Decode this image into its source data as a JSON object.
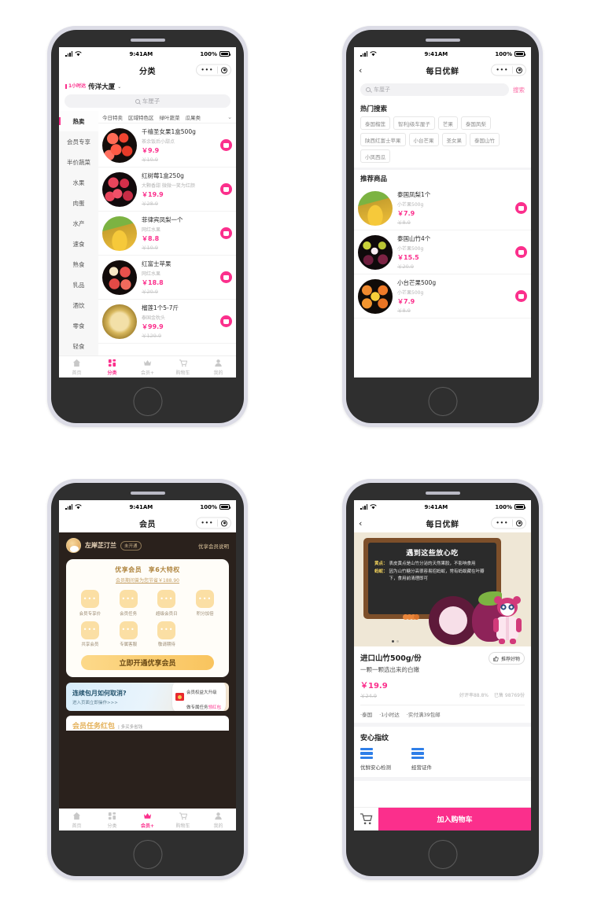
{
  "statusbar": {
    "time": "9:41AM",
    "battery": "100%"
  },
  "phone1": {
    "nav_title": "分类",
    "delivery_badge": "1小时达",
    "location": "传洋大厦",
    "search_placeholder": "车厘子",
    "sidebar": [
      {
        "label": "热卖",
        "active": true
      },
      {
        "label": "会员专享",
        "active": false
      },
      {
        "label": "半价蔬菜",
        "active": false
      },
      {
        "label": "水果",
        "active": false
      },
      {
        "label": "肉蛋",
        "active": false
      },
      {
        "label": "水产",
        "active": false
      },
      {
        "label": "速食",
        "active": false
      },
      {
        "label": "熟食",
        "active": false
      },
      {
        "label": "乳品",
        "active": false
      },
      {
        "label": "酒饮",
        "active": false
      },
      {
        "label": "零食",
        "active": false
      },
      {
        "label": "轻食",
        "active": false
      }
    ],
    "filter_tabs": [
      "今日特卖",
      "区域特色区",
      "绿叶蔬菜",
      "瓜果类"
    ],
    "filter_more": "⌄",
    "products": [
      {
        "title": "千禧圣女果1盒500g",
        "sub": "茶余饭后小甜点",
        "price": "￥9.9",
        "old": "￥10.9",
        "img": "cherry-tomato"
      },
      {
        "title": "红树莓1盒250g",
        "sub": "大颗香甜 微微一笑为红颜",
        "price": "￥19.9",
        "old": "￥28.9",
        "img": "raspberry"
      },
      {
        "title": "菲律宾凤梨一个",
        "sub": "网红水果",
        "price": "￥8.8",
        "old": "￥10.9",
        "img": "pineapple"
      },
      {
        "title": "红富士苹果",
        "sub": "网红水果",
        "price": "￥18.8",
        "old": "￥20.9",
        "img": "apple"
      },
      {
        "title": "榴莲1个5-7斤",
        "sub": "泰国金枕头",
        "price": "￥99.9",
        "old": "￥129.9",
        "img": "durian"
      }
    ],
    "tabbar": [
      {
        "label": "首页",
        "icon": "home-icon",
        "active": false
      },
      {
        "label": "分类",
        "icon": "grid-icon",
        "active": true
      },
      {
        "label": "会员+",
        "icon": "crown-icon",
        "active": false
      },
      {
        "label": "购物车",
        "icon": "cart-icon",
        "active": false
      },
      {
        "label": "我的",
        "icon": "person-icon",
        "active": false
      }
    ]
  },
  "phone2": {
    "nav_title": "每日优鲜",
    "search_placeholder": "车厘子",
    "search_button": "搜索",
    "hot_title": "热门搜索",
    "hot_tags": [
      "泰国榴莲",
      "智利J级车厘子",
      "芒果",
      "泰国凤梨",
      "陕西红富士苹果",
      "小台芒果",
      "圣女果",
      "泰国山竹",
      "小凤西瓜"
    ],
    "rec_title": "推荐商品",
    "products": [
      {
        "title": "泰国凤梨1个",
        "sub": "小芒果500g",
        "price": "￥7.9",
        "old": "￥8.9",
        "img": "pineapple"
      },
      {
        "title": "泰国山竹4个",
        "sub": "小芒果500g",
        "price": "￥15.5",
        "old": "￥20.9",
        "img": "mangosteen"
      },
      {
        "title": "小台芒果500g",
        "sub": "小芒果500g",
        "price": "￥7.9",
        "old": "￥8.9",
        "img": "mango"
      }
    ]
  },
  "phone3": {
    "nav_title": "会员",
    "username": "左岸芷汀兰",
    "user_badge": "未开通",
    "explain_link": "优享会员说明",
    "card_title": "优享会员　享6大特权",
    "card_sub": "会员期间曾为您节省￥188.90",
    "privileges": [
      {
        "label": "会员专享价",
        "icon": "tag-icon"
      },
      {
        "label": "会员任务",
        "icon": "task-icon"
      },
      {
        "label": "超级会员日",
        "icon": "calendar-icon"
      },
      {
        "label": "积分加倍",
        "icon": "points-icon"
      },
      {
        "label": "共享会员",
        "icon": "share-icon"
      },
      {
        "label": "专属客服",
        "icon": "service-icon"
      },
      {
        "label": "敬请期待",
        "icon": "more-icon"
      }
    ],
    "cta": "立即开通优享会员",
    "banner_title": "连续包月如何取消?",
    "banner_sub": "进入页面立即操作>>>",
    "banner_right_1": "会员权益大升级",
    "banner_right_2": "做专属任务",
    "banner_right_2b": "领红包",
    "redpack_title": "会员任务红包",
    "redpack_sub": "| 多买多省钱",
    "tabbar": [
      {
        "label": "首页",
        "icon": "home-icon",
        "active": false
      },
      {
        "label": "分类",
        "icon": "grid-icon",
        "active": false
      },
      {
        "label": "会员+",
        "icon": "crown-icon",
        "active": true
      },
      {
        "label": "购物车",
        "icon": "cart-icon",
        "active": false
      },
      {
        "label": "我的",
        "icon": "person-icon",
        "active": false
      }
    ]
  },
  "phone4": {
    "nav_title": "每日优鲜",
    "board_title": "遇到这些放心吃",
    "board_lines": [
      {
        "key": "黄点：",
        "val": "表皮黄点是山竹分泌的天然果胶，不影响食用"
      },
      {
        "key": "蚂蚁：",
        "val": "因为山竹糖分高很容易招蚂蚁，常有蚂蚁藏在叶瓣下，食用前清理即可"
      }
    ],
    "product_title": "进口山竹500g/份",
    "product_sub": "一颗一颗选出来的白嫩",
    "recommend_btn": "推荐好物",
    "price": "￥19.9",
    "old_price": "￥24.9",
    "rating": "好评率88.8%",
    "sold": "已售 98769份",
    "meta": [
      "·泰国",
      "·1小时达",
      "·实付满39包邮"
    ],
    "section_title": "安心指纹",
    "certs": [
      {
        "label": "优鲜安心检测",
        "icon": "certificate-icon"
      },
      {
        "label": "经营证件",
        "icon": "license-icon"
      }
    ],
    "add_cart": "加入购物车",
    "cart_icon": "cart-icon"
  },
  "colors": {
    "accent": "#fb2f8c",
    "gold": "#f9c45e",
    "dark": "#2a211c"
  }
}
